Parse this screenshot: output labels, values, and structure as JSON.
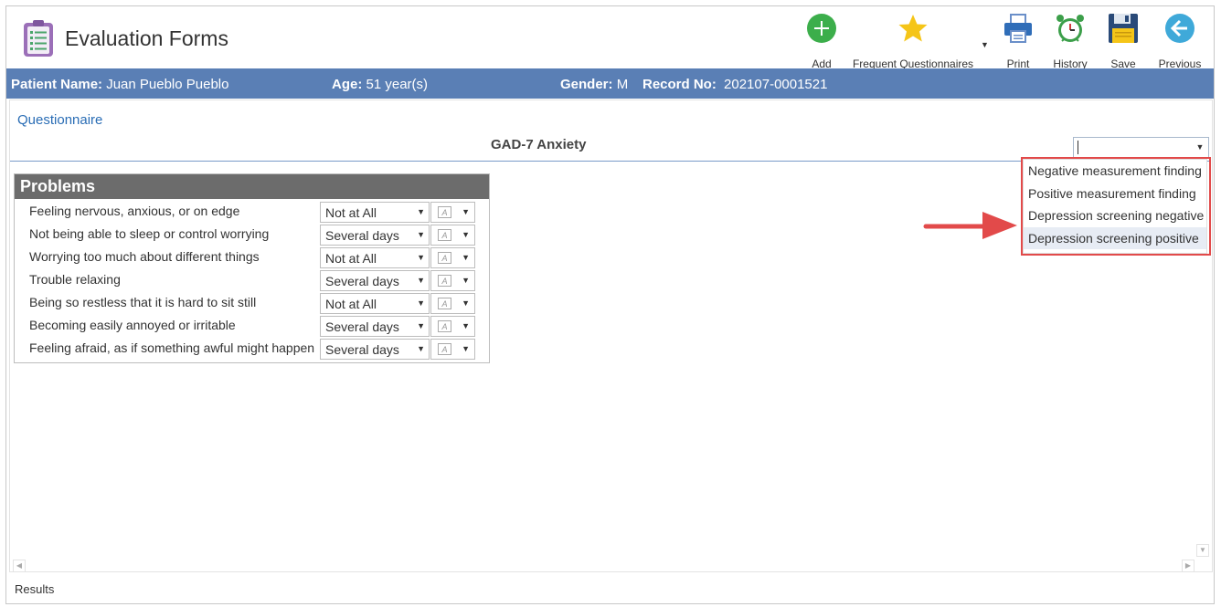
{
  "app": {
    "title": "Evaluation Forms",
    "icon": "clipboard-list-icon"
  },
  "toolbar": {
    "add": {
      "label": "Add",
      "icon": "plus-circle-icon",
      "color": "#3cae4b"
    },
    "frequent": {
      "label": "Frequent Questionnaires",
      "icon": "star-icon",
      "color": "#f5c518"
    },
    "print": {
      "label": "Print",
      "icon": "printer-icon"
    },
    "history": {
      "label": "History",
      "icon": "alarm-clock-icon"
    },
    "save": {
      "label": "Save",
      "icon": "floppy-disk-icon"
    },
    "previous": {
      "label": "Previous",
      "icon": "arrow-left-circle-icon",
      "color": "#3fa9d9"
    }
  },
  "patient": {
    "name_label": "Patient Name:",
    "name_value": "Juan Pueblo Pueblo",
    "age_label": "Age:",
    "age_value": "51 year(s)",
    "gender_label": "Gender:",
    "gender_value": "M",
    "record_label": "Record No:",
    "record_value": "202107-0001521",
    "bar_color": "#5a7fb5"
  },
  "questionnaire": {
    "link": "Questionnaire",
    "title": "GAD-7 Anxiety",
    "select_value": "",
    "options": [
      "Negative measurement finding",
      "Positive measurement finding",
      "Depression screening negative",
      "Depression screening positive"
    ],
    "highlight_color": "#e24a4a"
  },
  "problems": {
    "heading": "Problems",
    "rows": [
      {
        "label": "Feeling nervous, anxious, or on edge",
        "answer": "Not at All"
      },
      {
        "label": "Not being able to sleep or control worrying",
        "answer": "Several days"
      },
      {
        "label": "Worrying too much about different things",
        "answer": "Not at All"
      },
      {
        "label": "Trouble relaxing",
        "answer": "Several days"
      },
      {
        "label": "Being so restless that it is hard to sit still",
        "answer": "Not at All"
      },
      {
        "label": "Becoming easily annoyed or irritable",
        "answer": "Several days"
      },
      {
        "label": "Feeling afraid, as if something awful might happen",
        "answer": "Several days"
      }
    ]
  },
  "footer": {
    "results": "Results"
  }
}
